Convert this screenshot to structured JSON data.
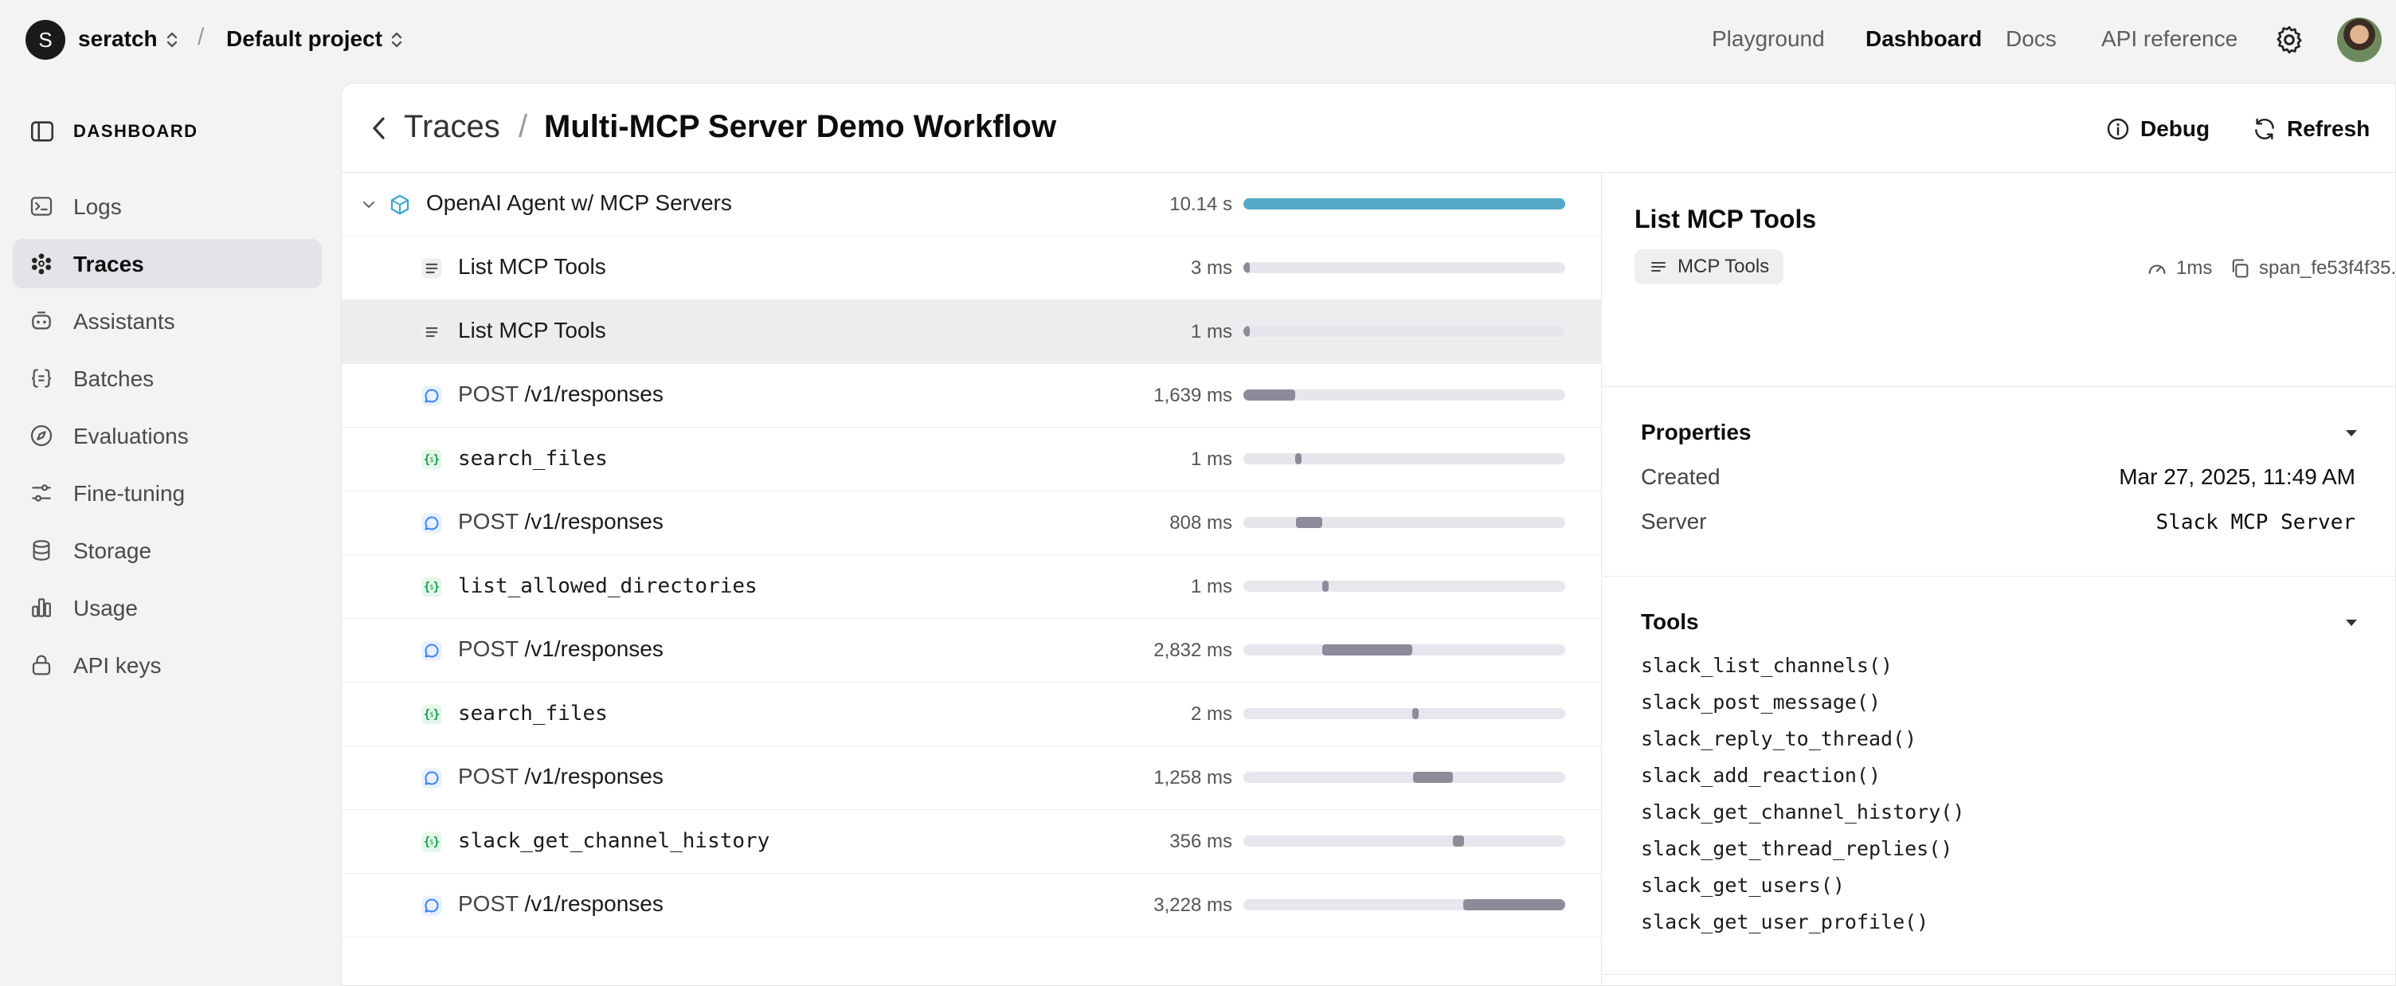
{
  "topbar": {
    "org_initial": "S",
    "org_name": "seratch",
    "separator": "/",
    "project_name": "Default project",
    "nav": [
      "Playground",
      "Dashboard",
      "Docs",
      "API reference"
    ],
    "active_nav": "Dashboard"
  },
  "sidebar": {
    "title": "DASHBOARD",
    "items": [
      {
        "label": "Logs",
        "icon": "terminal-icon"
      },
      {
        "label": "Traces",
        "icon": "traces-icon",
        "active": true
      },
      {
        "label": "Assistants",
        "icon": "robot-icon"
      },
      {
        "label": "Batches",
        "icon": "braces-icon"
      },
      {
        "label": "Evaluations",
        "icon": "compass-icon"
      },
      {
        "label": "Fine-tuning",
        "icon": "sliders-icon"
      },
      {
        "label": "Storage",
        "icon": "database-icon"
      },
      {
        "label": "Usage",
        "icon": "bar-chart-icon"
      },
      {
        "label": "API keys",
        "icon": "lock-icon"
      }
    ]
  },
  "header": {
    "breadcrumb_parent": "Traces",
    "breadcrumb_sep": "/",
    "title": "Multi-MCP Server Demo Workflow",
    "debug_label": "Debug",
    "refresh_label": "Refresh"
  },
  "spans": [
    {
      "type": "agent",
      "name": "OpenAI Agent w/ MCP Servers",
      "duration": "10.14 s",
      "start": 0.0,
      "width": 1.0
    },
    {
      "type": "list",
      "name": "List MCP Tools",
      "duration": "3 ms",
      "start": 0.0,
      "width": 0.01
    },
    {
      "type": "list",
      "name": "List MCP Tools",
      "duration": "1 ms",
      "start": 0.0,
      "width": 0.01,
      "selected": true
    },
    {
      "type": "response",
      "method": "POST",
      "name": "/v1/responses",
      "duration": "1,639 ms",
      "start": 0.0,
      "width": 0.162
    },
    {
      "type": "function",
      "name": "search_files",
      "duration": "1 ms",
      "start": 0.162,
      "width": 0.01
    },
    {
      "type": "response",
      "method": "POST",
      "name": "/v1/responses",
      "duration": "808 ms",
      "start": 0.164,
      "width": 0.08
    },
    {
      "type": "function",
      "name": "list_allowed_directories",
      "duration": "1 ms",
      "start": 0.244,
      "width": 0.01
    },
    {
      "type": "response",
      "method": "POST",
      "name": "/v1/responses",
      "duration": "2,832 ms",
      "start": 0.246,
      "width": 0.279
    },
    {
      "type": "function",
      "name": "search_files",
      "duration": "2 ms",
      "start": 0.525,
      "width": 0.01
    },
    {
      "type": "response",
      "method": "POST",
      "name": "/v1/responses",
      "duration": "1,258 ms",
      "start": 0.527,
      "width": 0.124
    },
    {
      "type": "function",
      "name": "slack_get_channel_history",
      "duration": "356 ms",
      "start": 0.651,
      "width": 0.035
    },
    {
      "type": "response",
      "method": "POST",
      "name": "/v1/responses",
      "duration": "3,228 ms",
      "start": 0.682,
      "width": 0.318
    }
  ],
  "detail": {
    "title": "List MCP Tools",
    "chip_label": "MCP Tools",
    "duration": "1ms",
    "span_id": "span_fe53f4f35...",
    "properties_title": "Properties",
    "properties": [
      {
        "key": "Created",
        "value": "Mar 27, 2025, 11:49 AM",
        "mono": false
      },
      {
        "key": "Server",
        "value": "Slack MCP Server",
        "mono": true
      }
    ],
    "tools_title": "Tools",
    "tools": [
      "slack_list_channels()",
      "slack_post_message()",
      "slack_reply_to_thread()",
      "slack_add_reaction()",
      "slack_get_channel_history()",
      "slack_get_thread_replies()",
      "slack_get_users()",
      "slack_get_user_profile()"
    ]
  },
  "colors": {
    "root_bar": "#54a9c8",
    "span_bar": "#8b8b99",
    "track": "#e6e6ec",
    "response_icon": "#3b82f6",
    "function_icon": "#16a34a",
    "agent_icon": "#3aa6c9"
  }
}
